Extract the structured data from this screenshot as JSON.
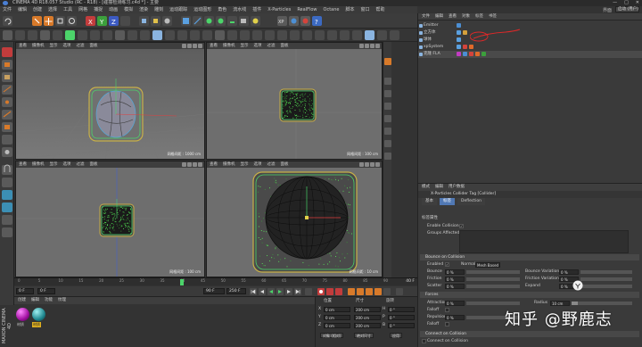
{
  "window": {
    "title": "CINEMA 4D R18.057 Studio (RC - R18) - [碰撞检测练习.c4d *] - 主要",
    "controls": [
      "—",
      "□",
      "✕"
    ]
  },
  "menubar": {
    "items": [
      "文件",
      "编辑",
      "创建",
      "选择",
      "工具",
      "网格",
      "捕捉",
      "动画",
      "模拟",
      "渲染",
      "雕刻",
      "运动跟踪",
      "运动图形",
      "角色",
      "流水线",
      "插件",
      "X-Particles",
      "RealFlow",
      "Octane",
      "脚本",
      "窗口",
      "帮助"
    ],
    "layout_label": "界面",
    "layout_value": "启动 (用户)"
  },
  "viewports": [
    {
      "name": "透视视图",
      "menu": [
        "查看",
        "摄像机",
        "显示",
        "选项",
        "过滤",
        "面板"
      ],
      "grid": "网格间距 : 1000 cm"
    },
    {
      "name": "顶视图",
      "menu": [
        "查看",
        "摄像机",
        "显示",
        "选项",
        "过滤",
        "面板"
      ],
      "grid": "网格间距 : 100 cm"
    },
    {
      "name": "右视图",
      "menu": [
        "查看",
        "摄像机",
        "显示",
        "选项",
        "过滤",
        "面板"
      ],
      "grid": "网格间距 : 100 cm"
    },
    {
      "name": "正视图",
      "menu": [
        "查看",
        "摄像机",
        "显示",
        "选项",
        "过滤",
        "面板"
      ],
      "grid": "网格间距 : 10 cm"
    }
  ],
  "object_manager": {
    "menu": [
      "文件",
      "编辑",
      "查看",
      "对象",
      "标签",
      "书签"
    ],
    "objects": [
      {
        "name": "Emitter",
        "tags": [
          "#4c8fd4"
        ],
        "selected": false
      },
      {
        "name": "立方体",
        "tags": [
          "#5aa0e0",
          "#d4a03c"
        ],
        "selected": false
      },
      {
        "name": "球体",
        "tags": [
          "#5aa0e0"
        ],
        "selected": false
      },
      {
        "name": "xpSystem",
        "tags": [
          "#5aa0e0",
          "#d4443c",
          "#e06a2a"
        ],
        "selected": false
      },
      {
        "name": "克隆 FLA",
        "tags": [
          "#c23cc2",
          "#4c8fd4",
          "#d4443c",
          "#e06a2a",
          "#3ca03c"
        ],
        "selected": true
      }
    ]
  },
  "attribute_manager": {
    "menu": [
      "模式",
      "编辑",
      "用户数据"
    ],
    "title": "X-Particles Collider Tag [Collider]",
    "tabs": [
      {
        "label": "基本",
        "active": false
      },
      {
        "label": "标签",
        "active": true
      },
      {
        "label": "Deflection",
        "active": false
      }
    ],
    "object_props_title": "标签属性",
    "enable_collisions": "Enable Collisions",
    "enable_collisions_checked": true,
    "groups_affected": "Groups Affected",
    "sections": {
      "bounce": "Bounce on Collision",
      "forces": "Forces",
      "connect": "Connect on Collision"
    },
    "bounce": {
      "enabled_label": "Enabled",
      "normals_label": "Normals",
      "normals_value": "Mesh Based",
      "bounce_label": "Bounce",
      "bounce_value": "0 %",
      "bounce_var_label": "Bounce Variation",
      "bounce_var_value": "0 %",
      "friction_label": "Friction",
      "friction_value": "0 %",
      "friction_var_label": "Friction Variation",
      "friction_var_value": "0 %",
      "scatter_label": "Scatter",
      "scatter_value": "0 %",
      "expand_label": "Expand",
      "expand_value": "0 %"
    },
    "forces": {
      "attraction_label": "Attraction",
      "attraction_value": "0 %",
      "radius_label": "Radius",
      "radius_value": "10 cm",
      "falloff_label": "Falloff",
      "repulsion_label": "Repulsion",
      "repulsion_value": "0 %",
      "falloff2_label": "Falloff"
    },
    "connect_label": "Connect on Collision"
  },
  "timeline": {
    "ticks": [
      "0",
      "5",
      "10",
      "15",
      "20",
      "25",
      "30",
      "35",
      "40",
      "45",
      "50",
      "55",
      "60",
      "65",
      "70",
      "75",
      "80",
      "85",
      "90"
    ],
    "current_frame": 40,
    "end_label": "40 F"
  },
  "transport": {
    "start": "0 F",
    "current": "0 F",
    "end": "90 F",
    "fps_field": "250 F"
  },
  "material_manager": {
    "menu": [
      "创建",
      "编辑",
      "功能",
      "纹理"
    ],
    "materials": [
      {
        "label": "材质",
        "color": "#c020c0"
      },
      {
        "label": "材质",
        "color": "#2a9fa8"
      }
    ]
  },
  "coordinates": {
    "headers": [
      "位置",
      "尺寸",
      "旋转"
    ],
    "rows": [
      {
        "axis": "X",
        "pos": "0 cm",
        "size": "200 cm",
        "rot_axis": "H",
        "rot": "0 °"
      },
      {
        "axis": "Y",
        "pos": "0 cm",
        "size": "200 cm",
        "rot_axis": "P",
        "rot": "0 °"
      },
      {
        "axis": "Z",
        "pos": "0 cm",
        "size": "200 cm",
        "rot_axis": "B",
        "rot": "0 °"
      }
    ],
    "mode": "对象 (相对)",
    "size_mode": "绝对尺寸",
    "apply": "应用"
  },
  "branding": {
    "maxon": "MAXON CINEMA 4D",
    "watermark": "知乎 @野鹿志"
  },
  "colors": {
    "selection_green": "#5cff5c",
    "x_axis": "#e04040",
    "y_axis": "#4cd46a",
    "z_axis": "#4060e0",
    "active_tab": "#5078b4"
  }
}
